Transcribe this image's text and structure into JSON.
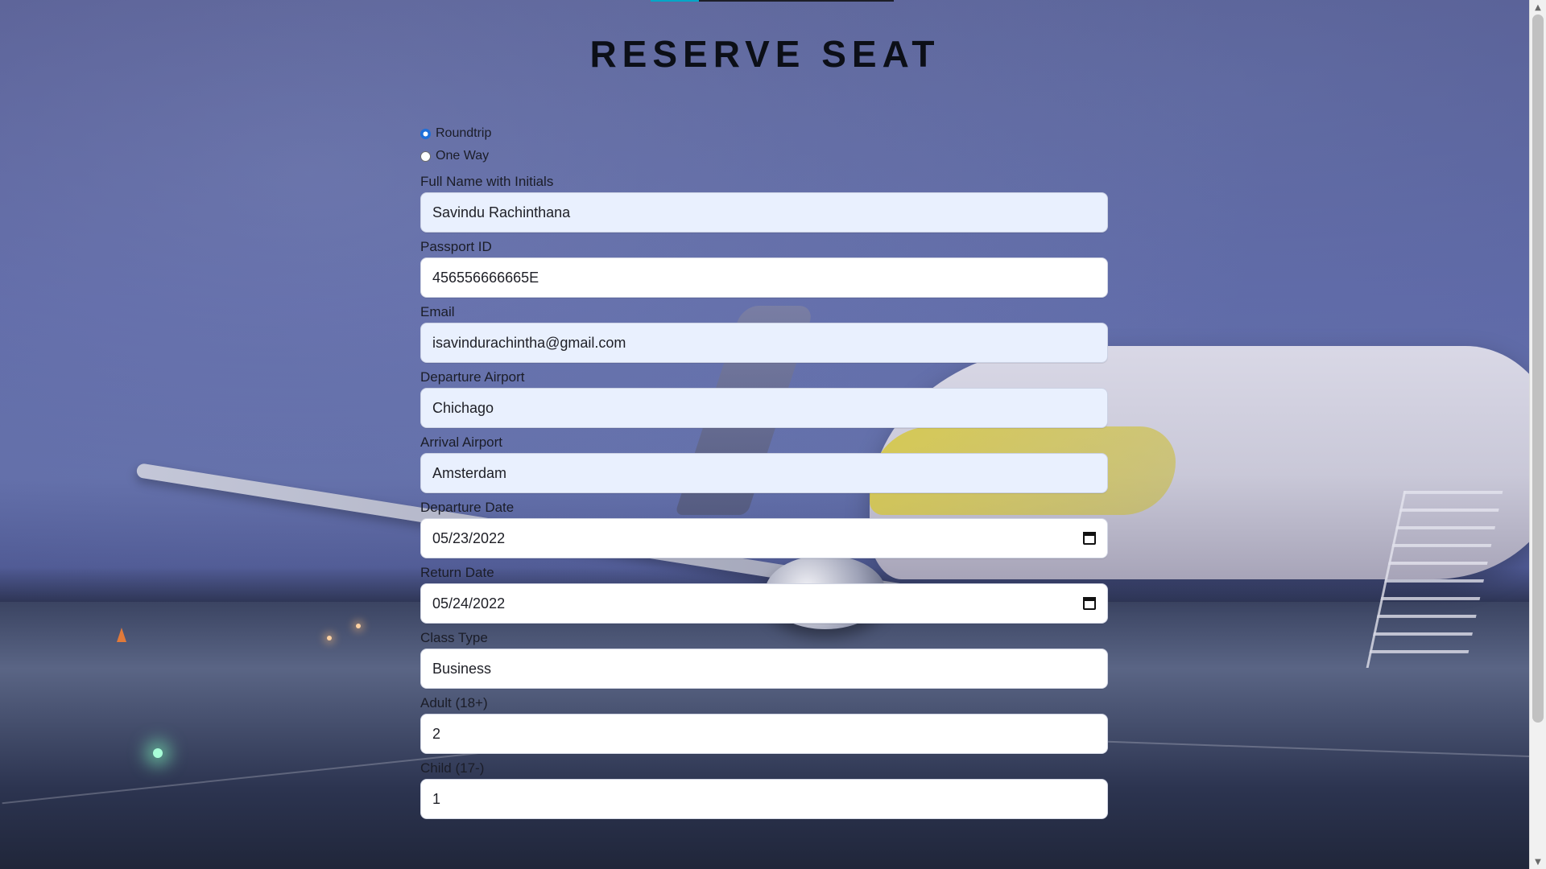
{
  "page": {
    "title": "RESERVE SEAT"
  },
  "trip_type": {
    "options": [
      {
        "label": "Roundtrip",
        "selected": true
      },
      {
        "label": "One Way",
        "selected": false
      }
    ]
  },
  "fields": {
    "full_name": {
      "label": "Full Name with Initials",
      "value": "Savindu Rachinthana"
    },
    "passport_id": {
      "label": "Passport ID",
      "value": "456556666665E"
    },
    "email": {
      "label": "Email",
      "value": "isavindurachintha@gmail.com"
    },
    "departure_airport": {
      "label": "Departure Airport",
      "value": "Chichago"
    },
    "arrival_airport": {
      "label": "Arrival Airport",
      "value": "Amsterdam"
    },
    "departure_date": {
      "label": "Departure Date",
      "value": "05/23/2022"
    },
    "return_date": {
      "label": "Return Date",
      "value": "05/24/2022"
    },
    "class_type": {
      "label": "Class Type",
      "value": "Business"
    },
    "adult": {
      "label": "Adult (18+)",
      "value": "2"
    },
    "child": {
      "label": "Child (17-)",
      "value": "1"
    }
  },
  "icons": {
    "calendar": "calendar-icon",
    "radio": "radio-button",
    "scroll_up": "chevron-up-icon",
    "scroll_down": "chevron-down-icon"
  },
  "colors": {
    "title": "#0c0f17",
    "autofill_bg": "#e9f0fe",
    "field_bg": "#ffffff",
    "radio_selected": "#1e6fd9",
    "top_progress": "#00a7c7"
  }
}
